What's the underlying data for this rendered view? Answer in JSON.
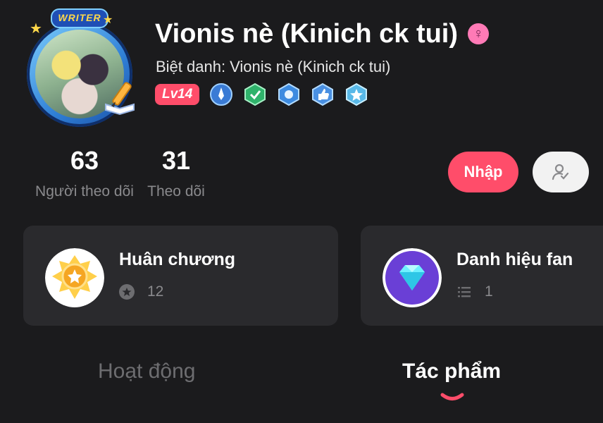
{
  "profile": {
    "username": "Vionis nè (Kinich ck tui)",
    "nickname_label": "Biệt danh:",
    "nickname": "Vionis nè (Kinich ck tui)",
    "writer_badge": "WRITER",
    "level": "Lv14",
    "gender_icon": "female-icon"
  },
  "stats": {
    "followers_value": "63",
    "followers_label": "Người theo dõi",
    "following_value": "31",
    "following_label": "Theo dõi"
  },
  "actions": {
    "import_label": "Nhập",
    "follow_icon": "user-check-icon"
  },
  "cards": {
    "medals": {
      "title": "Huân chương",
      "count": "12",
      "icon": "medal-icon"
    },
    "fan_title": {
      "title": "Danh hiệu fan",
      "count": "1",
      "icon": "diamond-icon"
    }
  },
  "tabs": {
    "activity": "Hoạt động",
    "works": "Tác phẩm",
    "active": "works"
  },
  "colors": {
    "accent": "#ff4d6a",
    "background": "#1b1b1d",
    "card": "#2a2a2d",
    "muted": "#8a8a8d"
  }
}
